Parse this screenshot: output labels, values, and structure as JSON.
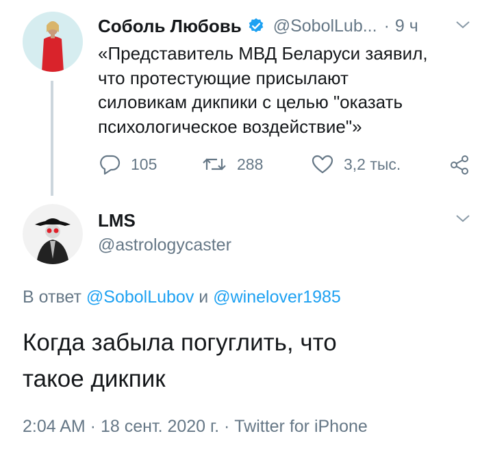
{
  "tweet1": {
    "author_name": "Соболь Любовь",
    "handle": "@SobolLub...",
    "separator": "·",
    "time": "9 ч",
    "text_lines": [
      "«Представитель МВД Беларуси заявил,",
      "что протестующие присылают",
      "силовикам дикпики с целью \"оказать",
      "психологическое воздействие\"»"
    ],
    "replies": "105",
    "retweets": "288",
    "likes": "3,2 тыс."
  },
  "tweet2": {
    "author_name": "LMS",
    "handle": "@astrologycaster",
    "reply_prefix": "В ответ",
    "reply_to_1": "@SobolLubov",
    "reply_and": "и",
    "reply_to_2": "@winelover1985",
    "text_lines": [
      "Когда забыла погуглить, что",
      "такое дикпик"
    ],
    "footer": "2:04 AM · 18 сент. 2020 г. · Twitter for iPhone"
  },
  "colors": {
    "link": "#1da1f2",
    "muted": "#657786",
    "verified": "#1da1f2",
    "thread_line": "#ccd6dd"
  },
  "icons": [
    "verified-badge-icon",
    "chevron-down-icon",
    "reply-icon",
    "retweet-icon",
    "like-icon",
    "share-icon"
  ]
}
